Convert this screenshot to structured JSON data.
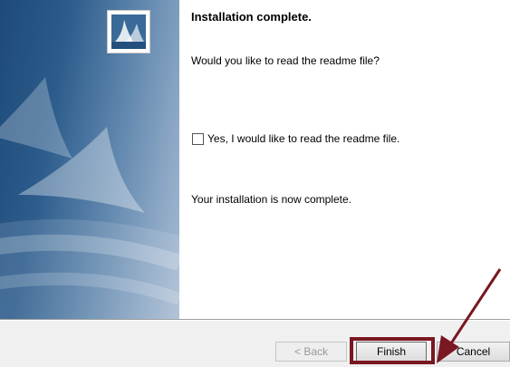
{
  "window": {
    "title": "Installation complete.",
    "question": "Would you like to read the readme file?",
    "checkbox_label": "Yes, I would like to read the readme file.",
    "checkbox_checked": false,
    "complete_message": "Your installation is now complete."
  },
  "buttons": {
    "back": "< Back",
    "finish": "Finish",
    "cancel": "Cancel"
  },
  "annotation": {
    "highlight_color": "#7a1722",
    "arrow_color": "#7a1722",
    "target": "finish-button"
  },
  "colors": {
    "side_panel_dark": "#1d4a78",
    "side_panel_light": "#a8bcd2",
    "footer_bg": "#f0f0f0"
  },
  "icons": [
    "installer-logo-icon",
    "sail-graphic"
  ]
}
